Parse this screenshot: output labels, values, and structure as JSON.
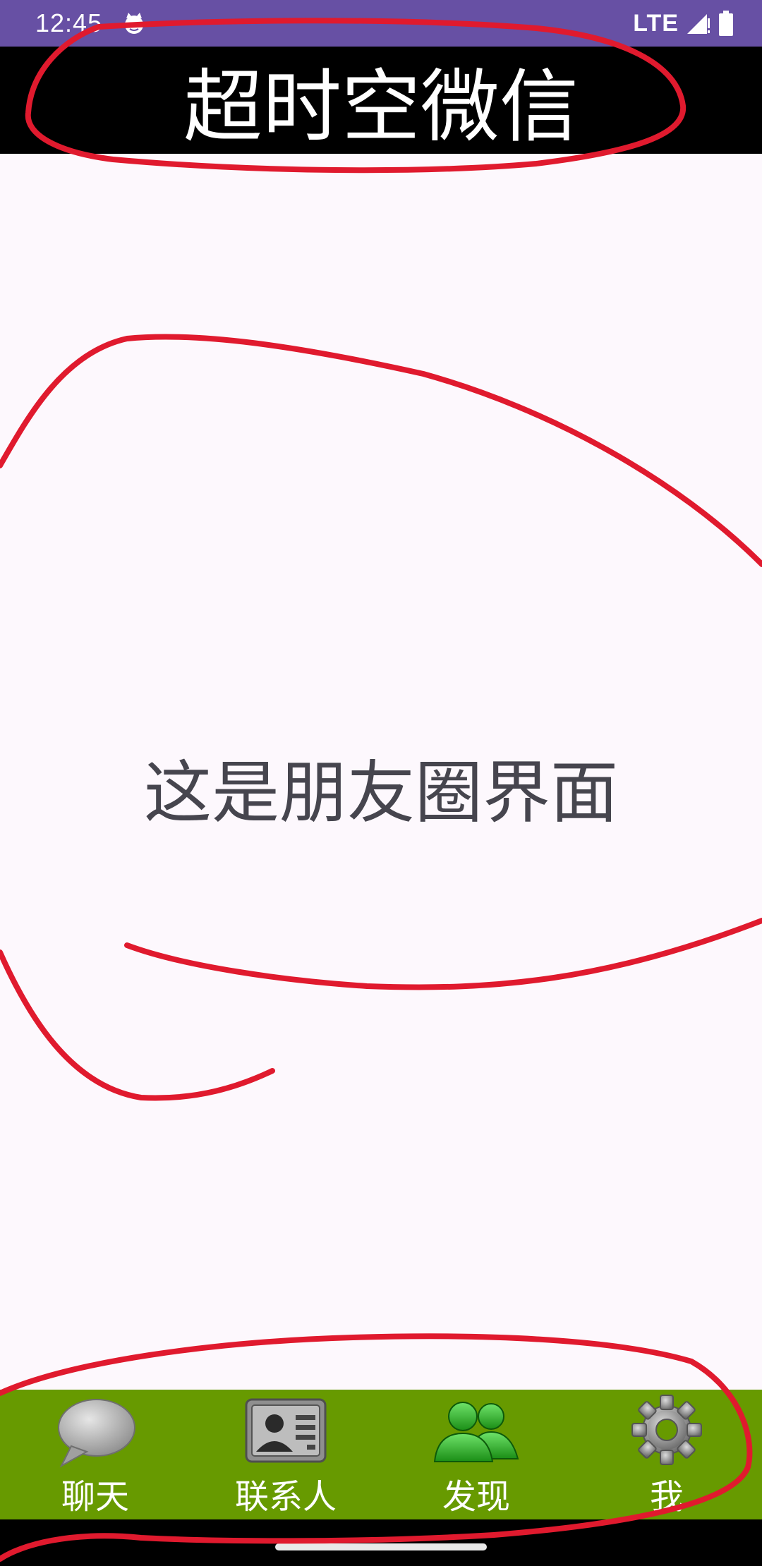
{
  "status_bar": {
    "time": "12:45",
    "network": "LTE",
    "icons": [
      "cat-icon",
      "signal-icon",
      "battery-icon"
    ]
  },
  "title_bar": {
    "title": "超时空微信"
  },
  "content": {
    "text": "这是朋友圈界面"
  },
  "bottom_nav": {
    "items": [
      {
        "label": "聊天",
        "icon": "chat-bubble-icon"
      },
      {
        "label": "联系人",
        "icon": "contact-card-icon"
      },
      {
        "label": "发现",
        "icon": "friends-icon"
      },
      {
        "label": "我",
        "icon": "gear-icon"
      }
    ]
  },
  "colors": {
    "status_bar": "#6750a4",
    "title_bar": "#000000",
    "background": "#fdf8fd",
    "nav_bar": "#679a00",
    "annotation": "#e01a2e",
    "content_text": "#46454e"
  }
}
